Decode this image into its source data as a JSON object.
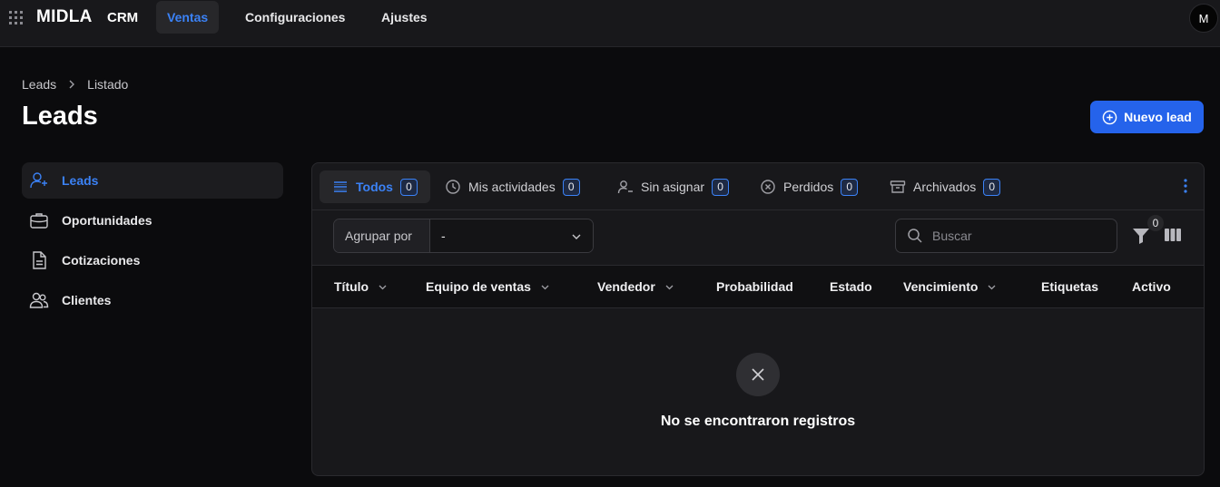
{
  "topbar": {
    "brand": "MIDLA",
    "app": "CRM",
    "nav": [
      {
        "label": "Ventas",
        "active": true
      },
      {
        "label": "Configuraciones",
        "active": false
      },
      {
        "label": "Ajustes",
        "active": false
      }
    ],
    "avatar": "M"
  },
  "breadcrumb": [
    "Leads",
    "Listado"
  ],
  "page_title": "Leads",
  "new_button": "Nuevo lead",
  "sidebar": {
    "items": [
      {
        "label": "Leads",
        "icon": "user-plus-icon",
        "active": true
      },
      {
        "label": "Oportunidades",
        "icon": "briefcase-icon",
        "active": false
      },
      {
        "label": "Cotizaciones",
        "icon": "document-icon",
        "active": false
      },
      {
        "label": "Clientes",
        "icon": "users-icon",
        "active": false
      }
    ]
  },
  "tabs": [
    {
      "label": "Todos",
      "count": "0",
      "icon": "list-icon",
      "active": true
    },
    {
      "label": "Mis actividades",
      "count": "0",
      "icon": "clock-icon",
      "active": false
    },
    {
      "label": "Sin asignar",
      "count": "0",
      "icon": "user-minus-icon",
      "active": false
    },
    {
      "label": "Perdidos",
      "count": "0",
      "icon": "x-circle-icon",
      "active": false
    },
    {
      "label": "Archivados",
      "count": "0",
      "icon": "archive-icon",
      "active": false
    }
  ],
  "toolbar": {
    "group_by_label": "Agrupar por",
    "group_by_value": "-",
    "search_placeholder": "Buscar",
    "filter_count": "0"
  },
  "table": {
    "columns": [
      "Título",
      "Equipo de ventas",
      "Vendedor",
      "Probabilidad",
      "Estado",
      "Vencimiento",
      "Etiquetas",
      "Activo"
    ],
    "empty_message": "No se encontraron registros"
  },
  "colors": {
    "accent": "#3b82f6",
    "primary_button": "#2563eb",
    "background": "#0b0b0d",
    "panel": "#18181b"
  }
}
